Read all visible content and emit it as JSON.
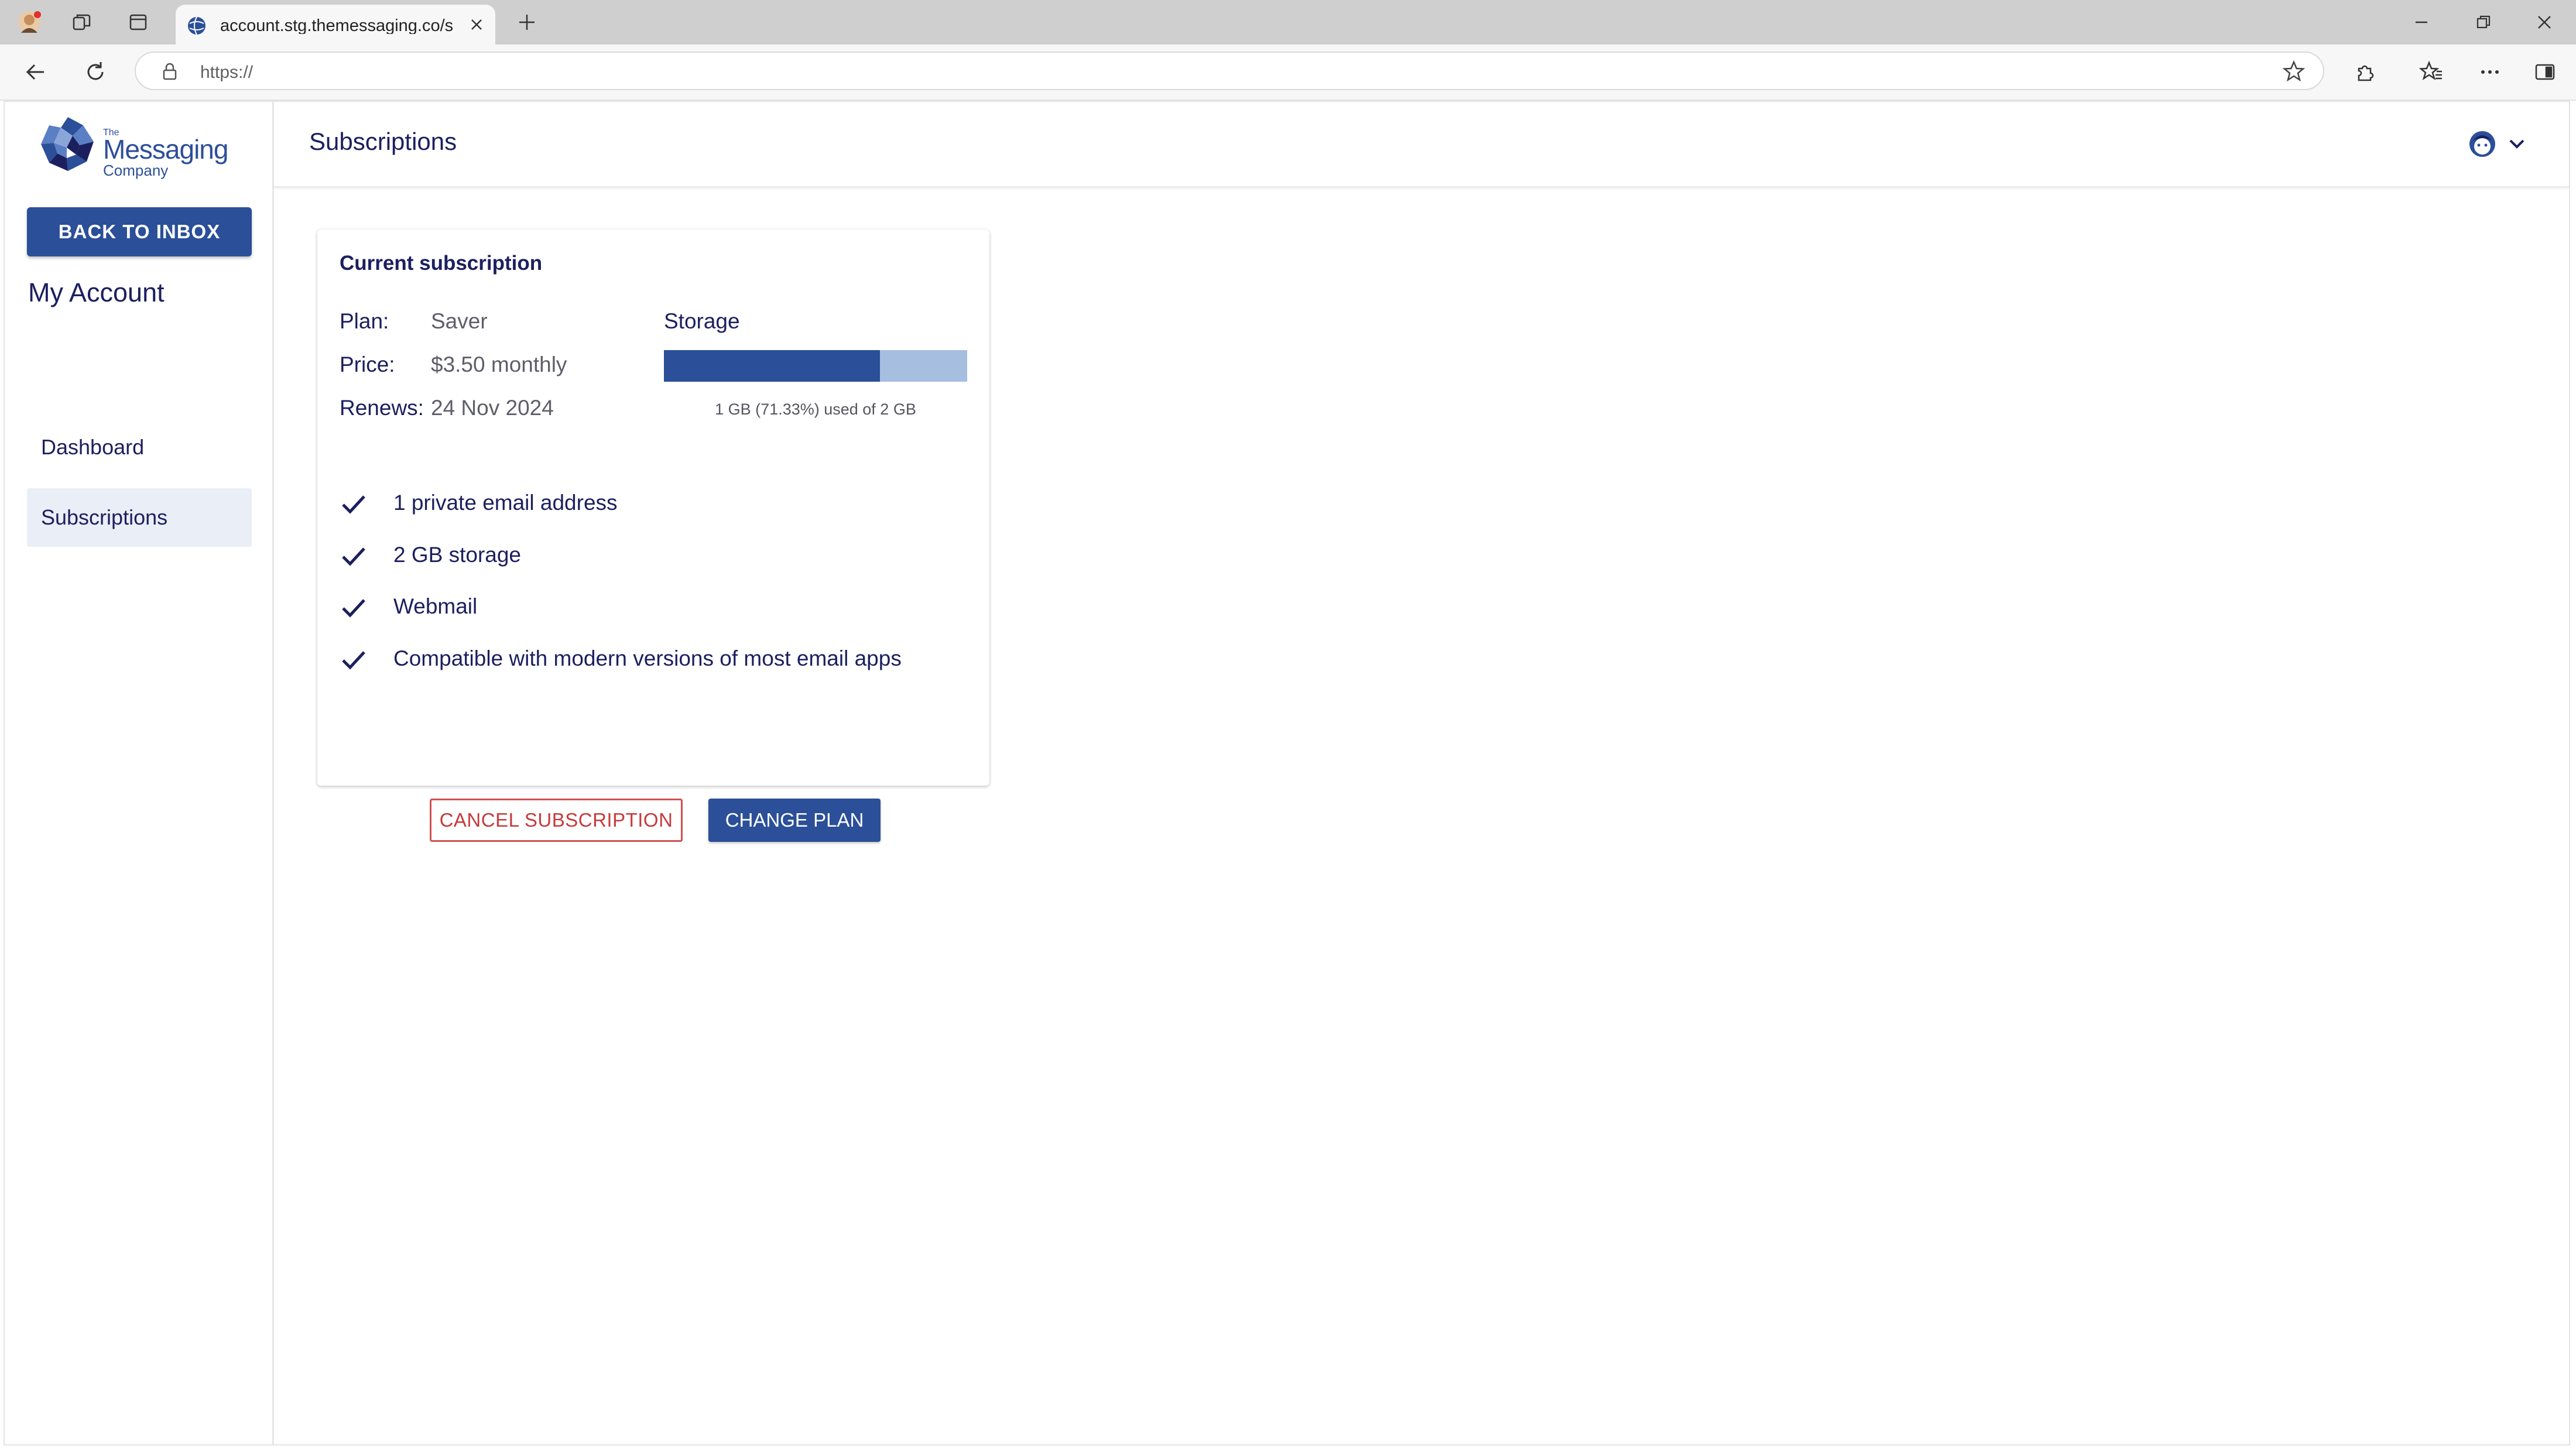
{
  "browser": {
    "tab_title": "account.stg.themessaging.co/subscriptions",
    "address": "https://",
    "new_tab_symbol": "+"
  },
  "sidebar": {
    "logo": {
      "line1": "The",
      "line2": "Messaging",
      "line3": "Company"
    },
    "back_button": "BACK TO INBOX",
    "section_title": "My Account",
    "items": [
      {
        "label": "Dashboard",
        "active": false
      },
      {
        "label": "Subscriptions",
        "active": true
      }
    ]
  },
  "header": {
    "title": "Subscriptions"
  },
  "subscription": {
    "card_title": "Current subscription",
    "plan_label": "Plan:",
    "plan_value": "Saver",
    "price_label": "Price:",
    "price_value": "$3.50 monthly",
    "renews_label": "Renews:",
    "renews_value": "24 Nov 2024",
    "storage": {
      "title": "Storage",
      "used_fraction": 0.7133,
      "caption": "1 GB (71.33%) used of 2 GB"
    },
    "features": [
      "1 private email address",
      "2 GB storage",
      "Webmail",
      "Compatible with modern versions of most email apps"
    ],
    "cancel_button": "CANCEL SUBSCRIPTION",
    "change_button": "CHANGE PLAN"
  },
  "colors": {
    "brand_blue": "#2b4f98",
    "text_navy": "#1c1f5e",
    "storage_track": "#a6bee0",
    "cancel_red": "#c53b3b"
  }
}
